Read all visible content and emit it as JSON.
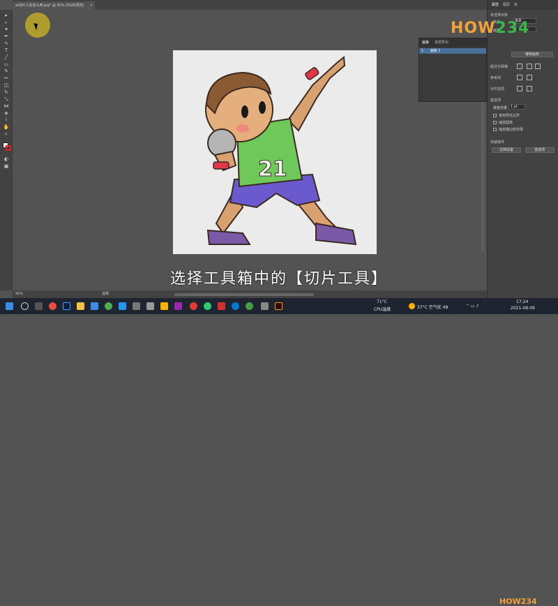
{
  "document": {
    "tab_title": "ai切片工具怎么用.jpg* @ 50% (RGB/预览)",
    "zoom": "50%",
    "status_tool": "选择"
  },
  "subtitle": "选择工具箱中的【切片工具】",
  "logo": {
    "text": "HOW234",
    "bottom_text": "HOW234"
  },
  "properties_panel": {
    "tabs": [
      "属性",
      "图层",
      "库"
    ],
    "no_selection": "未选择对象",
    "unit_label": "单位",
    "unit_value": "像素",
    "artboard_label": "画板",
    "artboard_value": "1",
    "edit_artboards_button": "编辑画板",
    "align_section": "版式与网格",
    "reference_label": "参考线",
    "align_options_label": "对齐选项",
    "preferences_section": "首选项",
    "keyboard_increment_label": "键盘增量",
    "keyboard_increment_value": "1 pt",
    "option_preview_bounds": "使用预览边界",
    "option_scale_corners": "缩放圆角",
    "option_scale_strokes": "缩放描边和效果",
    "quick_actions_section": "快速操作",
    "document_setup_button": "文档设置",
    "preferences_button": "首选项"
  },
  "artboards_panel": {
    "tabs": [
      "画板",
      "资源导出"
    ],
    "rows": [
      {
        "index": "1",
        "name": "画板 1"
      }
    ]
  },
  "illustration": {
    "jersey_number": "21"
  },
  "taskbar": {
    "temperature": "71°C",
    "cpu_label": "CPU温度",
    "weather": "37°C 空气优 48",
    "date": "2021-08-09",
    "time": "17:24"
  },
  "colors": {
    "workspace": "#535353",
    "panel": "#424242",
    "accent_blue": "#4a6f99",
    "logo_orange": "#f2a23a",
    "logo_green": "#39b54a"
  }
}
